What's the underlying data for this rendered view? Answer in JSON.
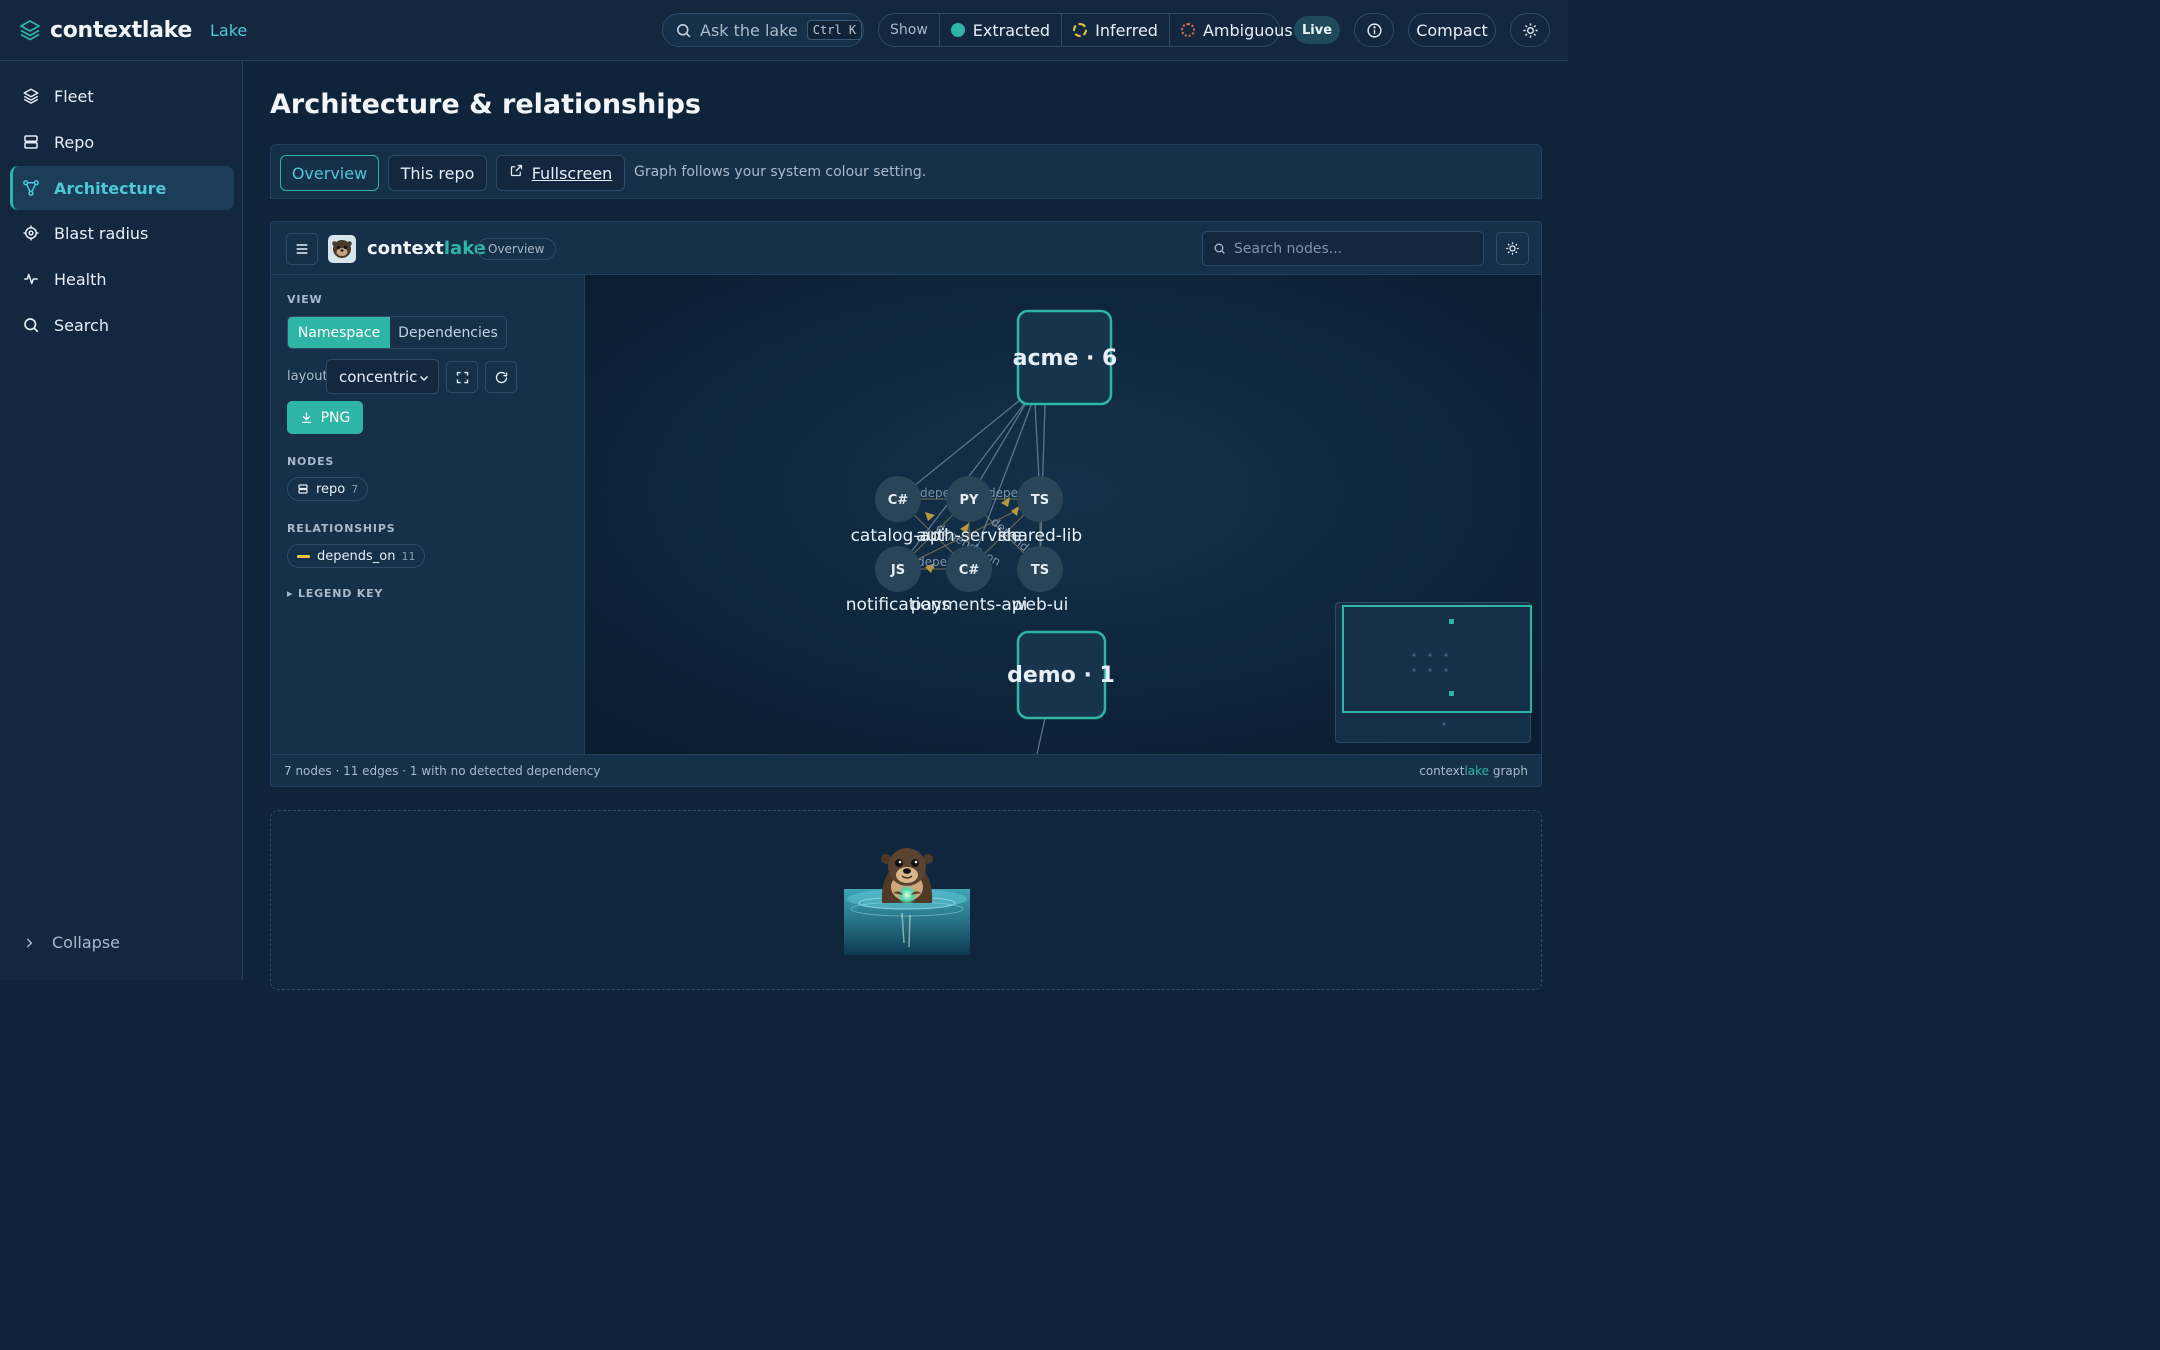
{
  "app": {
    "brand": "contextlake",
    "section_label": "Lake"
  },
  "topbar": {
    "ask_placeholder": "Ask the lake",
    "ask_shortcut": "Ctrl K",
    "show_label": "Show",
    "filters": [
      {
        "label": "Extracted",
        "color": "#2fb5a6"
      },
      {
        "label": "Inferred",
        "color": "#e8c23a"
      },
      {
        "label": "Ambiguous",
        "color": "#e06a4a"
      }
    ],
    "live_label": "Live",
    "compact_label": "Compact"
  },
  "sidebar": {
    "items": [
      {
        "label": "Fleet",
        "icon": "layers-icon"
      },
      {
        "label": "Repo",
        "icon": "server-icon"
      },
      {
        "label": "Architecture",
        "icon": "graph-icon",
        "active": true
      },
      {
        "label": "Blast radius",
        "icon": "target-icon"
      },
      {
        "label": "Health",
        "icon": "pulse-icon"
      },
      {
        "label": "Search",
        "icon": "search-icon"
      }
    ],
    "collapse_label": "Collapse"
  },
  "page": {
    "title": "Architecture & relationships",
    "tabs": [
      {
        "label": "Overview",
        "active": true
      },
      {
        "label": "This repo"
      },
      {
        "label": "Fullscreen"
      }
    ],
    "tab_hint": "Graph follows your system colour setting."
  },
  "graph_panel": {
    "brand_prefix": "context",
    "brand_suffix": "lake",
    "badge": "Overview",
    "search_placeholder": "Search nodes...",
    "view_label": "VIEW",
    "view_options": [
      "Namespace",
      "Dependencies"
    ],
    "view_selected": "Namespace",
    "layout_label": "layout",
    "layout_value": "concentric",
    "png_label": "PNG",
    "nodes_label": "NODES",
    "node_types": [
      {
        "label": "repo",
        "count": "7"
      }
    ],
    "relationships_label": "RELATIONSHIPS",
    "relationship_types": [
      {
        "label": "depends_on",
        "count": "11",
        "color": "#e8c23a"
      }
    ],
    "legend_key_label": "▸ LEGEND KEY",
    "footer_stats": "7 nodes · 11 edges · 1 with no detected dependency",
    "footer_credit_prefix": "context",
    "footer_credit_accent": "lake",
    "footer_credit_suffix": " graph"
  },
  "graph": {
    "namespaces": [
      {
        "label": "acme · 6"
      },
      {
        "label": "demo · 1"
      }
    ],
    "repos": [
      {
        "lang": "C#",
        "name": "catalog-api"
      },
      {
        "lang": "PY",
        "name": "auth-service"
      },
      {
        "lang": "TS",
        "name": "shared-lib"
      },
      {
        "lang": "JS",
        "name": "notifications"
      },
      {
        "lang": "C#",
        "name": "payments-api"
      },
      {
        "lang": "TS",
        "name": "web-ui"
      }
    ],
    "edge_label": "depends_on"
  }
}
